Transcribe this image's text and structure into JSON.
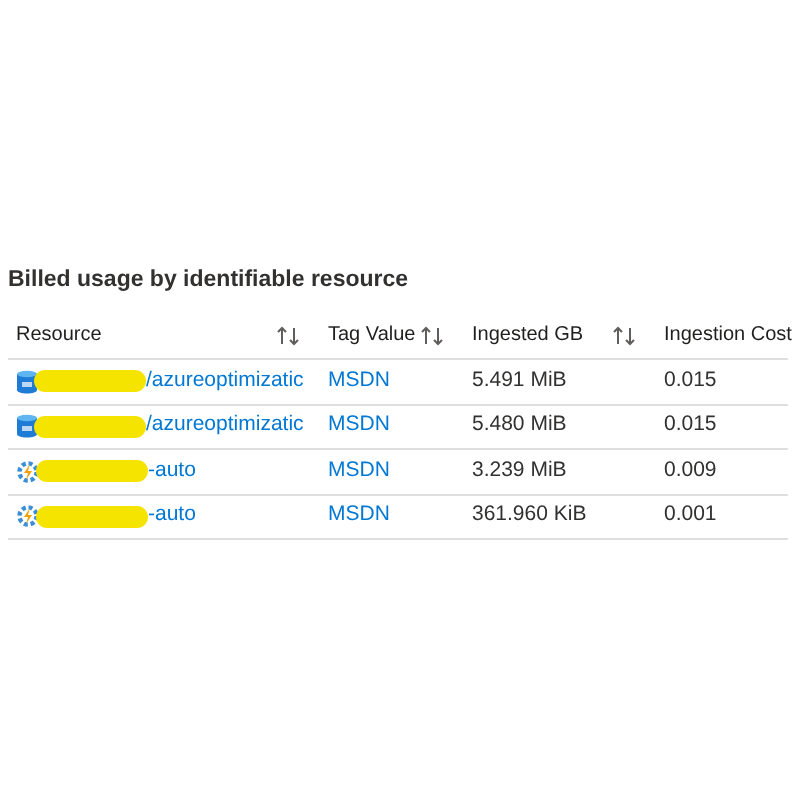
{
  "section_title": "Billed usage by identifiable resource",
  "table": {
    "columns": [
      {
        "label": "Resource",
        "sortable": true
      },
      {
        "label": "Tag Value",
        "sortable": true
      },
      {
        "label": "Ingested GB",
        "sortable": true
      },
      {
        "label": "Ingestion Cost",
        "sortable": false
      }
    ],
    "rows": [
      {
        "kind": "database",
        "redacted": true,
        "resource": "/azureoptimizatic",
        "tag": "MSDN",
        "ingested": "5.491 MiB",
        "cost": "0.015"
      },
      {
        "kind": "database",
        "redacted": true,
        "resource": "/azureoptimizatic",
        "tag": "MSDN",
        "ingested": "5.480 MiB",
        "cost": "0.015"
      },
      {
        "kind": "automation",
        "redacted": true,
        "resource": "-auto",
        "tag": "MSDN",
        "ingested": "3.239 MiB",
        "cost": "0.009"
      },
      {
        "kind": "automation",
        "redacted": true,
        "resource": "-auto",
        "tag": "MSDN",
        "ingested": "361.960 KiB",
        "cost": "0.001"
      }
    ]
  }
}
